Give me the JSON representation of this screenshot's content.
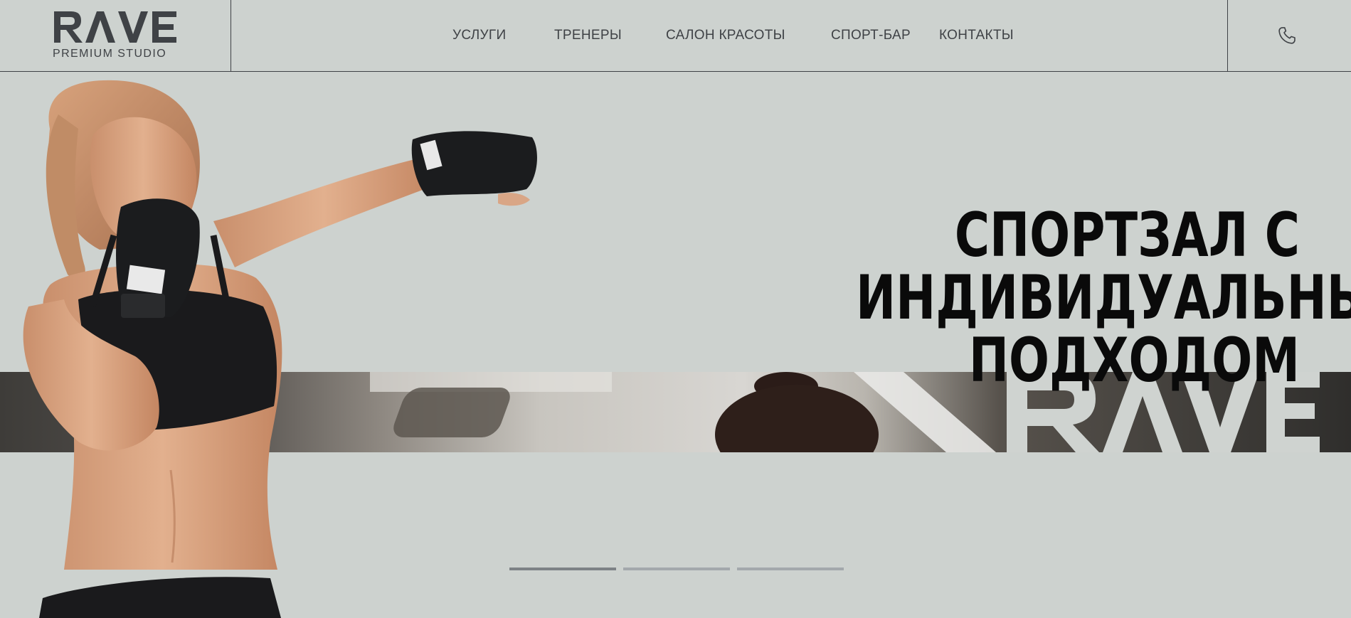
{
  "brand": {
    "name": "RAVE",
    "subtitle": "PREMIUM STUDIO"
  },
  "nav": {
    "items": [
      {
        "label": "УСЛУГИ"
      },
      {
        "label": "ТРЕНЕРЫ"
      },
      {
        "label": "САЛОН КРАСОТЫ"
      },
      {
        "label": "СПОРТ-БАР"
      },
      {
        "label": "КОНТАКТЫ"
      }
    ]
  },
  "header": {
    "phone_icon": "phone-icon"
  },
  "hero": {
    "headline_lines": [
      "СПОРТЗАЛ С",
      "ИНДИВИДУАЛЬНЫМ",
      "ПОДХОДОМ"
    ],
    "banner_mark": "RAVE",
    "slides": {
      "count": 3,
      "active_index": 0
    }
  },
  "colors": {
    "background": "#cdd2cf",
    "text_dark": "#3f4246",
    "headline": "#0a0a0a",
    "slider_active": "#7d8286",
    "slider_inactive": "#a3a8ac"
  }
}
